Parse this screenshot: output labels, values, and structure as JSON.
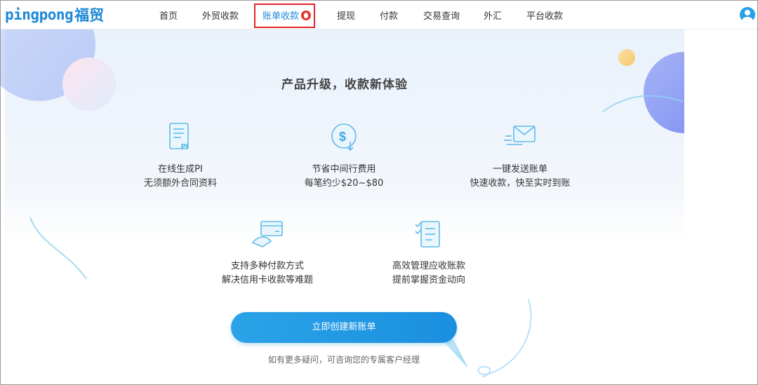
{
  "header": {
    "logo_text": "pingpong",
    "logo_cn": "福贸",
    "nav": [
      {
        "label": "首页",
        "active": false
      },
      {
        "label": "外贸收款",
        "active": false
      },
      {
        "label": "账单收款",
        "active": true
      },
      {
        "label": "提现",
        "active": false
      },
      {
        "label": "付款",
        "active": false
      },
      {
        "label": "交易查询",
        "active": false
      },
      {
        "label": "外汇",
        "active": false
      },
      {
        "label": "平台收款",
        "active": false
      }
    ]
  },
  "main": {
    "title": "产品升级，收款新体验",
    "features": [
      {
        "icon": "pi-document-icon",
        "line1": "在线生成PI",
        "line2": "无须额外合同资料"
      },
      {
        "icon": "dollar-coin-icon",
        "line1": "节省中间行费用",
        "line2": "每笔约少$20~$80"
      },
      {
        "icon": "send-mail-icon",
        "line1": "一键发送账单",
        "line2": "快速收款，快至实时到账"
      },
      {
        "icon": "credit-card-icon",
        "line1": "支持多种付款方式",
        "line2": "解决信用卡收款等难题"
      },
      {
        "icon": "checklist-icon",
        "line1": "高效管理应收账款",
        "line2": "提前掌握资金动向"
      }
    ],
    "cta_label": "立即创建新账单",
    "help_text": "如有更多疑问，可咨询您的专属客户经理"
  },
  "colors": {
    "brand": "#1e88d8",
    "cta": "#2399e4",
    "active_border": "#e0252a",
    "badge": "#e0392f"
  }
}
